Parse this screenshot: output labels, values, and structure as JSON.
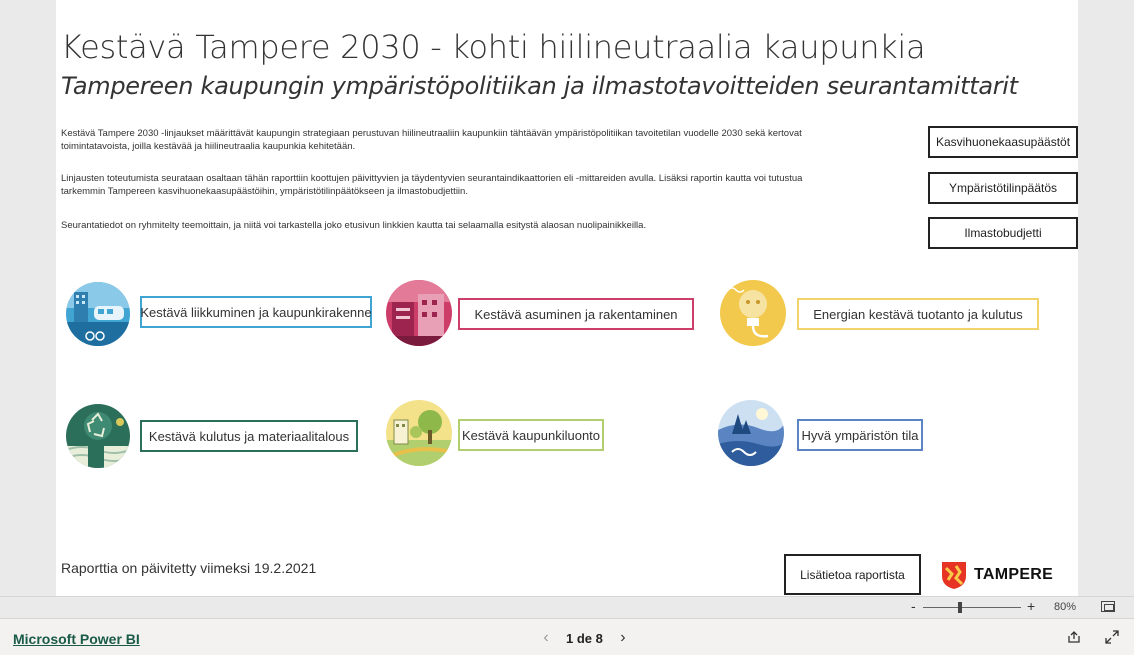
{
  "report": {
    "title": "Kestävä Tampere 2030 - kohti hiilineutraalia kaupunkia",
    "subtitle": "Tampereen kaupungin ympäristöpolitiikan ja ilmastotavoitteiden seurantamittarit",
    "paragraphs": [
      "Kestävä Tampere 2030 -linjaukset määrittävät kaupungin strategiaan perustuvan hiilineutraaliin kaupunkiin tähtäävän ympäristöpolitiikan tavoitetilan vuodelle 2030 sekä kertovat toimintatavoista, joilla kestävää ja hiilineutraalia kaupunkia kehitetään.",
      "Linjausten toteutumista seurataan osaltaan tähän raporttiin koottujen päivittyvien ja täydentyvien seurantaindikaattorien eli -mittareiden avulla. Lisäksi raportin kautta voi tutustua tarkemmin Tampereen kasvihuonekaasupäästöihin, ympäristötilinpäätökseen ja ilmastobudjettiin.",
      "Seurantatiedot on ryhmitelty teemoittain, ja niitä voi tarkastella joko etusivun linkkien kautta tai selaamalla esitystä alaosan nuolipainikkeilla."
    ],
    "side_buttons": [
      "Kasvihuonekaasupäästöt",
      "Ympäristötilinpäätös",
      "Ilmastobudjetti"
    ],
    "topics": [
      {
        "label": "Kestävä liikkuminen ja kaupunkirakenne",
        "icon": "transport-icon",
        "color": "#41a5d4"
      },
      {
        "label": "Kestävä asuminen ja rakentaminen",
        "icon": "housing-icon",
        "color": "#cc3d6a"
      },
      {
        "label": "Energian kestävä tuotanto ja kulutus",
        "icon": "energy-icon",
        "color": "#f2d36b"
      },
      {
        "label": "Kestävä kulutus ja materiaalitalous",
        "icon": "recycle-icon",
        "color": "#2b6e5a"
      },
      {
        "label": "Kestävä kaupunkiluonto",
        "icon": "nature-icon",
        "color": "#b2cf6f"
      },
      {
        "label": "Hyvä ympäristön tila",
        "icon": "environment-icon",
        "color": "#5b85c2"
      }
    ],
    "updated": "Raporttia on päivitetty viimeksi 19.2.2021",
    "more_info": "Lisätietoa raportista",
    "logo_text": "TAMPERE"
  },
  "zoom": {
    "minus": "-",
    "plus": "+",
    "percent": "80%",
    "level": 0.8
  },
  "footer": {
    "brand": "Microsoft Power BI",
    "page_text": "1 de 8"
  }
}
